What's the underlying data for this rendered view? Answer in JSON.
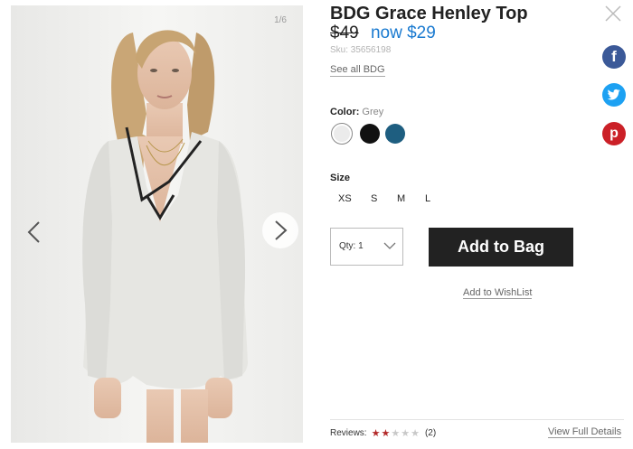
{
  "gallery": {
    "counter": "1/6",
    "prev_icon": "chevron-left-icon",
    "next_icon": "chevron-right-icon",
    "image_alt": "Model wearing BDG Grace Henley Top in grey"
  },
  "product": {
    "title": "BDG Grace Henley Top",
    "old_price": "$49",
    "new_price": "now $29",
    "sku": "Sku: 35656198",
    "see_all": "See all BDG"
  },
  "close_icon": "close-icon",
  "share": {
    "facebook": "f",
    "twitter": "t",
    "pinterest": "p"
  },
  "color": {
    "label": "Color:",
    "selected": "Grey",
    "swatches": [
      "#ebebeb",
      "#111111",
      "#1e5e80"
    ]
  },
  "size": {
    "label": "Size",
    "options": [
      "XS",
      "S",
      "M",
      "L"
    ]
  },
  "quantity": {
    "label": "Qty: 1"
  },
  "add_to_bag": "Add to Bag",
  "wishlist": "Add to WishList",
  "reviews": {
    "label": "Reviews:",
    "rating": 2,
    "max": 5,
    "count": "(2)"
  },
  "full_details": "View Full Details",
  "colors": {
    "price_accent": "#1a7ad0",
    "button_bg": "#222222",
    "star_on": "#b32a2a",
    "facebook": "#3b5998",
    "twitter": "#1da1f2",
    "pinterest": "#cb2027"
  }
}
